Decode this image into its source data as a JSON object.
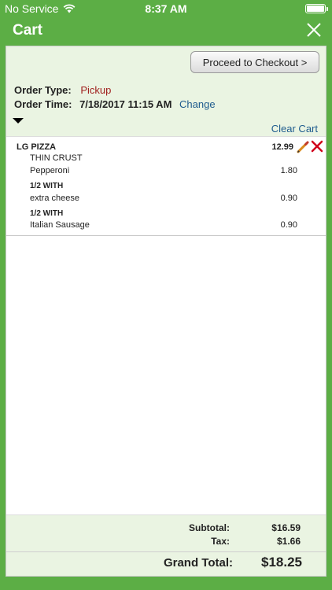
{
  "status_bar": {
    "carrier": "No Service",
    "time": "8:37 AM"
  },
  "nav": {
    "title": "Cart"
  },
  "header": {
    "checkout_label": "Proceed to Checkout >",
    "order_type_label": "Order Type:",
    "order_type_value": "Pickup",
    "order_time_label": "Order Time:",
    "order_time_value": "7/18/2017 11:15 AM",
    "change_label": "Change",
    "clear_cart_label": "Clear Cart"
  },
  "item": {
    "name": "LG PIZZA",
    "price": "12.99",
    "lines": [
      {
        "text": "THIN CRUST",
        "price": ""
      },
      {
        "text": "Pepperoni",
        "price": "1.80"
      },
      {
        "text": "1/2 WITH",
        "price": ""
      },
      {
        "text": "extra cheese",
        "price": "0.90"
      },
      {
        "text": "1/2 WITH",
        "price": ""
      },
      {
        "text": "Italian Sausage",
        "price": "0.90"
      }
    ]
  },
  "totals": {
    "subtotal_label": "Subtotal:",
    "subtotal_value": "$16.59",
    "tax_label": "Tax:",
    "tax_value": "$1.66",
    "grand_total_label": "Grand Total:",
    "grand_total_value": "$18.25"
  },
  "colors": {
    "nav_green": "#5cae45",
    "header_bg": "#eaf4e2",
    "pickup_red": "#a0201e",
    "link_blue": "#1f5c8e"
  },
  "icons": {
    "wifi": "wifi-icon",
    "battery": "battery-icon",
    "close": "close-icon",
    "edit": "pencil-icon",
    "delete": "delete-x-icon",
    "caret": "caret-down-icon"
  }
}
